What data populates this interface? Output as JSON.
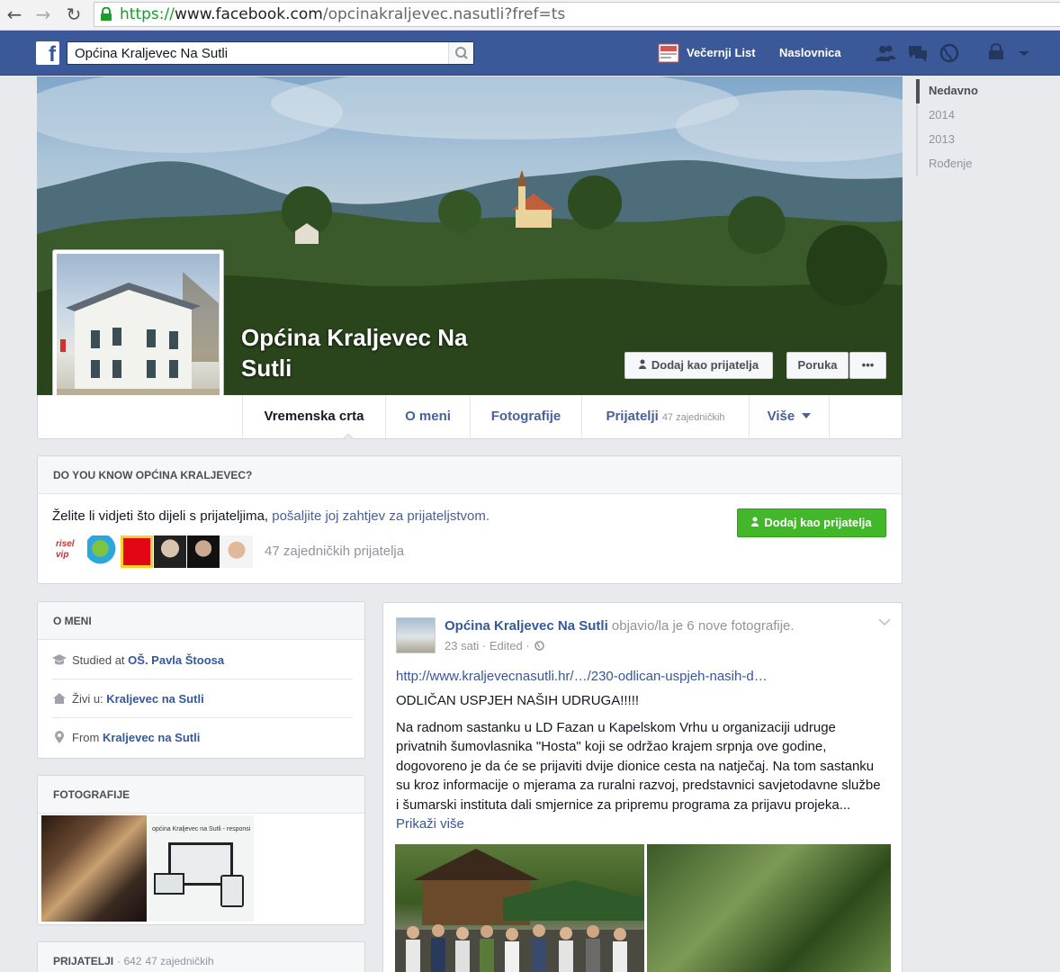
{
  "browser": {
    "url_scheme": "https://",
    "url_host": "www.facebook.com",
    "url_path": "/opcinakraljevec.nasutli?fref=ts"
  },
  "header": {
    "logo_letter": "f",
    "search_value": "Općina Kraljevec Na Sutli",
    "app_label": "Večernji List",
    "home_label": "Naslovnica"
  },
  "profile": {
    "name": "Općina Kraljevec Na Sutli",
    "add_friend_label": "Dodaj kao prijatelja",
    "message_label": "Poruka",
    "more_label": "•••"
  },
  "tabs": [
    {
      "label": "Vremenska crta"
    },
    {
      "label": "O meni"
    },
    {
      "label": "Fotografije"
    },
    {
      "label": "Prijatelji",
      "count": "47 zajedničkih"
    },
    {
      "label": "Više"
    }
  ],
  "timeline_nav": [
    "Nedavno",
    "2014",
    "2013",
    "Rođenje"
  ],
  "dyk": {
    "title": "DO YOU KNOW OPĆINA KRALJEVEC?",
    "text": "Želite li vidjeti što dijeli s prijateljima, ",
    "link": "pošaljite joj zahtjev za prijateljstvom.",
    "button": "Dodaj kao prijatelja",
    "thumb_logo_text": "risel vip",
    "mutual": "47 zajedničkih prijatelja"
  },
  "about": {
    "title": "O MENI",
    "rows": [
      {
        "prefix": "Studied at ",
        "value": "OŠ. Pavla Štoosa"
      },
      {
        "prefix": "Živi u: ",
        "value": "Kraljevec na Sutli"
      },
      {
        "prefix": "From ",
        "value": "Kraljevec na Sutli"
      }
    ]
  },
  "photos": {
    "title": "FOTOGRAFIJE",
    "photo2_caption": "općina Kraljevec na Sutli - responsi"
  },
  "friends": {
    "title": "PRIJATELJI",
    "count": "· 642",
    "mutual": "47 zajedničkih"
  },
  "post": {
    "author": "Općina Kraljevec Na Sutli",
    "action": " objavio/la je 6 nove fotografije.",
    "meta": "23 sati · Edited ·",
    "link": "http://www.kraljevecnasutli.hr/…/230-odlican-uspjeh-nasih-d…",
    "headline": "ODLIČAN USPJEH NAŠIH UDRUGA!!!!!",
    "body": "Na radnom sastanku u LD Fazan u Kapelskom Vrhu u organizaciji udruge privatnih šumovlasnika \"Hosta\" koji se održao krajem srpnja ove godine, dogovoreno je da će se prijaviti dvije dionice cesta na natječaj. Na tom sastanku su kroz informacije o mjerama za ruralni razvoj, predstavnici savjetodavne službe i šumarski instituta dali smjernice za pripremu programa za prijavu projeka... ",
    "more": "Prikaži više"
  },
  "colors": {
    "fb_blue": "#3b5998",
    "link": "#365899",
    "green": "#42b72a",
    "bg": "#e9eaed"
  }
}
